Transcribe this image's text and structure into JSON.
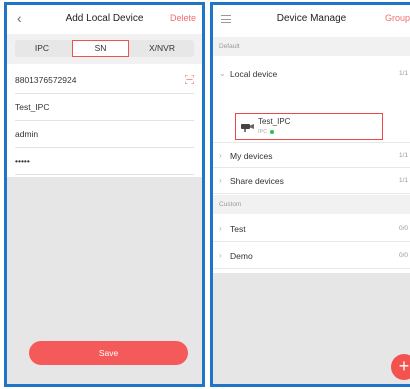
{
  "left": {
    "title": "Add Local Device",
    "back_icon": "‹",
    "action": "Delete",
    "segments": [
      "IPC",
      "SN",
      "X/NVR"
    ],
    "selected_segment": "SN",
    "fields": {
      "serial_number": "8801376572924",
      "device_name": "Test_IPC",
      "username": "admin",
      "password": "•••••"
    },
    "save_label": "Save",
    "accent": "#f55a5a"
  },
  "right": {
    "title": "Device Manage",
    "action": "Group",
    "default_section": "Default",
    "local_device": {
      "label": "Local device",
      "count": "1/1"
    },
    "device": {
      "name": "Test_IPC",
      "type": "IPC",
      "status_color": "#2ec240"
    },
    "my_devices": {
      "label": "My devices",
      "count": "1/1"
    },
    "share_devices": {
      "label": "Share devices",
      "count": "1/1"
    },
    "custom_section": "Custom",
    "groups": [
      {
        "label": "Test",
        "count": "0/0"
      },
      {
        "label": "Demo",
        "count": "0/0"
      }
    ],
    "fab_label": "+"
  },
  "border_color": "#1f76c6"
}
